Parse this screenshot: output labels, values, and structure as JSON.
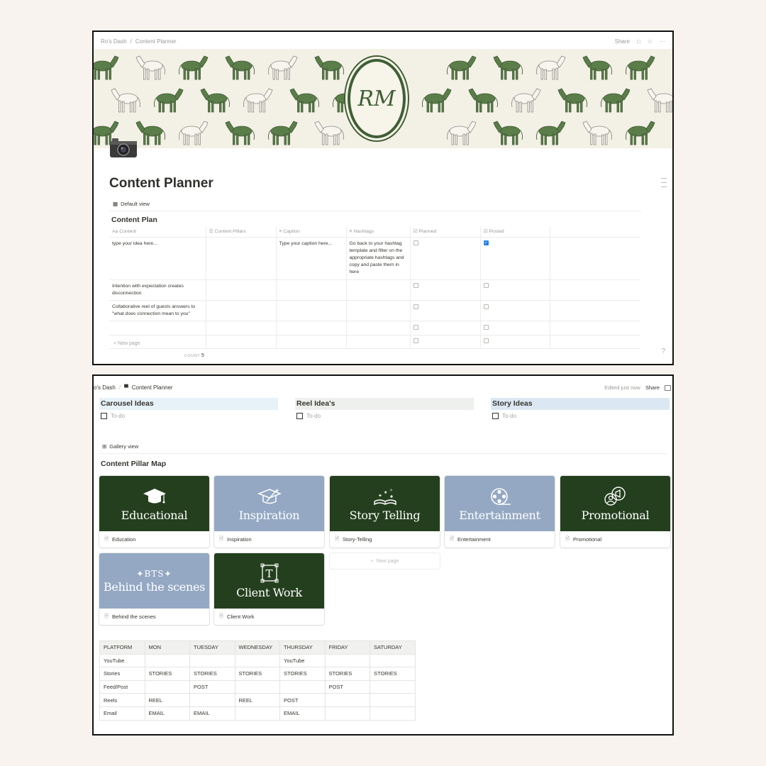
{
  "top": {
    "breadcrumb": [
      "Ro's Dash",
      "Content Planner"
    ],
    "topbar_right": "Share",
    "page_title": "Content Planner",
    "view": "Default view",
    "db_title": "Content Plan",
    "columns": [
      "Content",
      "Content Pillars",
      "Caption",
      "Hashtags",
      "Planned",
      "Posted"
    ],
    "rows": [
      {
        "content": "type your idea here...",
        "caption": "Type your caption here...",
        "hashtags": "Go back to your hashtag template and filter on the appropriate hashtags and copy and paste them in here",
        "planned": false,
        "posted": true
      },
      {
        "content": "Intention with expectation creates disconnection",
        "caption": "",
        "hashtags": "",
        "planned": false,
        "posted": false
      },
      {
        "content": "Collaborative reel of guests answers to \"what does connection mean to you\"",
        "caption": "",
        "hashtags": "",
        "planned": false,
        "posted": false
      },
      {
        "content": "",
        "caption": "",
        "hashtags": "",
        "planned": false,
        "posted": false
      },
      {
        "content": "",
        "caption": "",
        "hashtags": "",
        "planned": false,
        "posted": false
      }
    ],
    "new_page": "New page",
    "count_label": "COUNT",
    "count_value": "5",
    "monogram": "RM"
  },
  "bottom": {
    "breadcrumb": [
      "o's Dash",
      "Content Planner"
    ],
    "edited": "Edited just now",
    "share": "Share",
    "columns": [
      {
        "title": "Carousel Ideas",
        "todo": "To-do",
        "color": "#e7f1f8"
      },
      {
        "title": "Reel Idea's",
        "todo": "To-do",
        "color": "#edf0ec"
      },
      {
        "title": "Story Ideas",
        "todo": "To-do",
        "color": "#dbe7f2"
      }
    ],
    "gallery_view": "Gallery view",
    "gallery_title": "Content Pillar Map",
    "cards": [
      {
        "cover": "Educational",
        "name": "Education",
        "bg": "#243f1e",
        "icon": "graduation-cap-icon"
      },
      {
        "cover": "Inspiration",
        "name": "Inspiration",
        "bg": "#94a8c3",
        "icon": "graduation-cap-star-icon"
      },
      {
        "cover": "Story Telling",
        "name": "Story-Telling",
        "bg": "#243f1e",
        "icon": "open-book-icon"
      },
      {
        "cover": "Entertainment",
        "name": "Entertainment",
        "bg": "#94a8c3",
        "icon": "film-reel-icon"
      },
      {
        "cover": "Promotional",
        "name": "Promotional",
        "bg": "#243f1e",
        "icon": "megaphone-icon"
      },
      {
        "cover": "Behind the scenes",
        "cover_small": "BTS",
        "name": "Behind the scenes",
        "bg": "#94a8c3",
        "icon": "sparkle-icon"
      },
      {
        "cover": "Client Work",
        "name": "Client Work",
        "bg": "#243f1e",
        "icon": "text-frame-icon"
      }
    ],
    "new_page": "New page",
    "schedule": [
      [
        "PLATFORM",
        "MON",
        "TUESDAY",
        "WEDNESDAY",
        "THURSDAY",
        "FRIDAY",
        "SATURDAY"
      ],
      [
        "YouTube",
        "",
        "",
        "",
        "YouTube",
        "",
        ""
      ],
      [
        "Stories",
        "STORIES",
        "STORIES",
        "STORIES",
        "STORIES",
        "STORIES",
        "STORIES"
      ],
      [
        "Feed/Post",
        "",
        "POST",
        "",
        "",
        "POST",
        ""
      ],
      [
        "Reels",
        "REEL",
        "",
        "REEL",
        "POST",
        "",
        ""
      ],
      [
        "Email",
        "EMAIL",
        "EMAIL",
        "",
        "EMAIL",
        "",
        ""
      ]
    ]
  }
}
